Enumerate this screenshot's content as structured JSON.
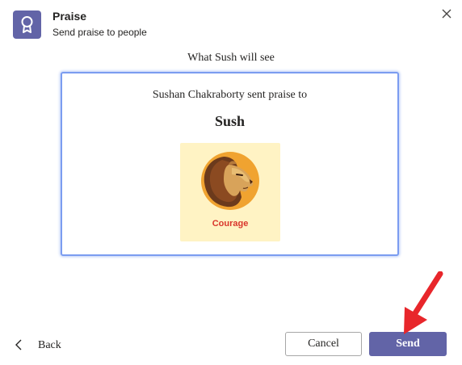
{
  "header": {
    "app_icon": "award-ribbon-icon",
    "title": "Praise",
    "subtitle": "Send praise to people",
    "close_icon": "close-icon"
  },
  "preview": {
    "heading": "What Sush will see",
    "sender_line": "Sushan Chakraborty sent praise to",
    "recipient": "Sush",
    "badge": {
      "icon": "lion-icon",
      "label": "Courage"
    }
  },
  "footer": {
    "back_label": "Back",
    "back_icon": "chevron-left-icon",
    "cancel_label": "Cancel",
    "send_label": "Send"
  },
  "annotation": {
    "icon": "red-arrow-icon"
  },
  "colors": {
    "accent": "#6264a7",
    "card_border": "#7b9cf0",
    "badge_bg": "#fff3c4",
    "badge_label": "#d9352b",
    "annotation_arrow": "#e8262b"
  }
}
